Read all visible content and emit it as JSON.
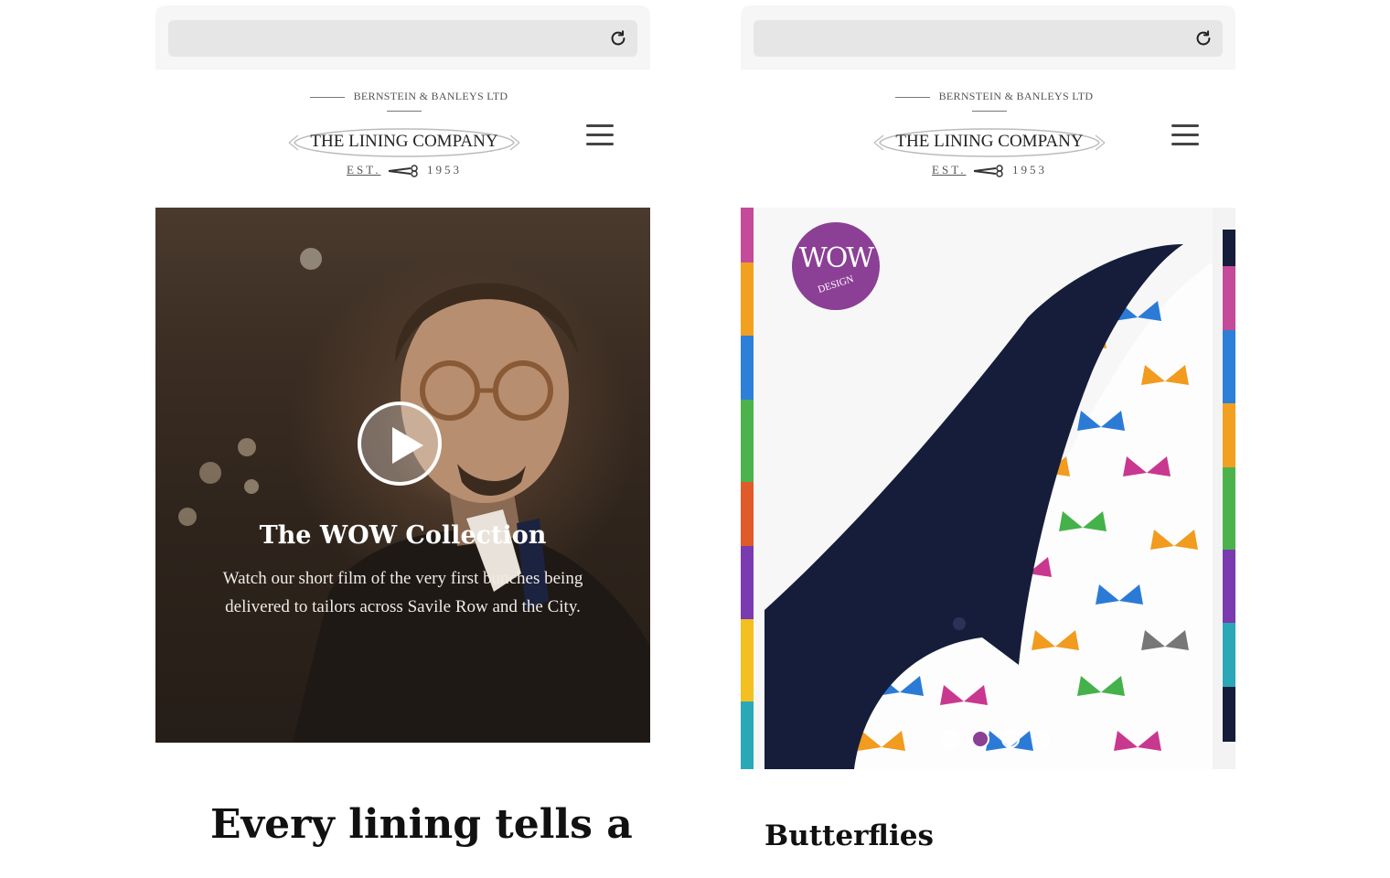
{
  "brand": {
    "parent_company": "BERNSTEIN & BANLEYS LTD",
    "name": "THE LINING COMPANY",
    "est_label": "EST.",
    "est_year": "1953"
  },
  "left_phone": {
    "hero": {
      "title": "The WOW Collection",
      "description": "Watch our short film of the very first bunches being delivered to tailors across Savile Row and the City."
    },
    "headline": "Every lining tells a"
  },
  "right_phone": {
    "badge": {
      "text": "WOW",
      "subtext": "DESIGN",
      "color": "#8b3f95"
    },
    "slide_title": "Butterflies",
    "carousel": {
      "slide_count": 4,
      "active_index": 1
    }
  },
  "icons": {
    "reload": "reload-icon",
    "menu": "hamburger-menu-icon",
    "play": "play-icon",
    "scissors": "scissors-icon"
  }
}
